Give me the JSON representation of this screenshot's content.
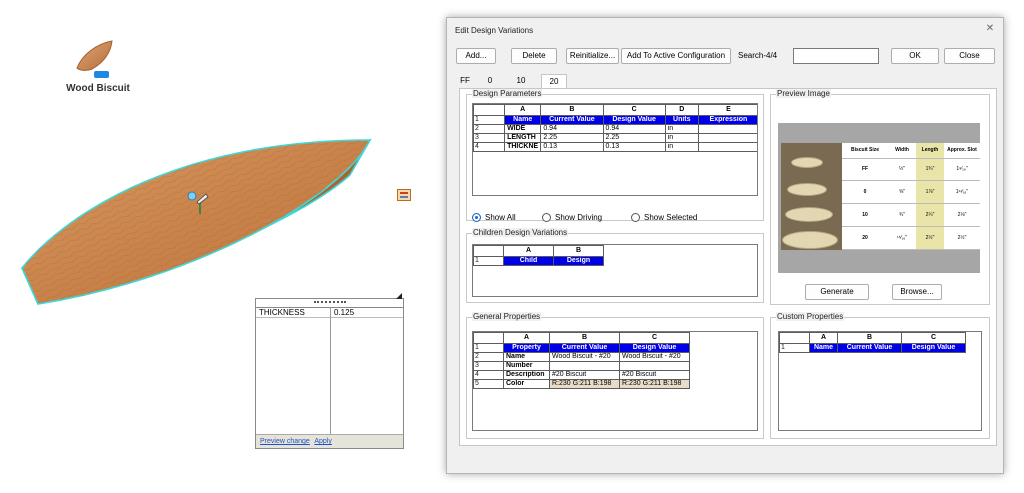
{
  "canvas": {
    "part_label": "Wood Biscuit",
    "part_badge": "•••",
    "equation": {
      "param_name": "THICKNESS",
      "param_value": "0.125",
      "preview_link": "Preview change",
      "apply_link": "Apply"
    }
  },
  "dialog": {
    "title": "Edit Design Variations",
    "toolbar": {
      "add": "Add...",
      "delete": "Delete",
      "reinitialize": "Reinitialize...",
      "add_to_config": "Add To Active Configuration",
      "search_label": "Search-4/4",
      "search_value": "",
      "ok": "OK",
      "close": "Close"
    },
    "tabs": [
      "FF",
      "0",
      "10",
      "20"
    ],
    "active_tab": "20",
    "design_parameters": {
      "label": "Design Parameters",
      "columns": [
        "A",
        "B",
        "C",
        "D",
        "E"
      ],
      "headers": [
        "Name",
        "Current Value",
        "Design Value",
        "Units",
        "Expression"
      ],
      "rows": [
        {
          "n": "2",
          "name": "WIDE",
          "current": "0.94",
          "design": "0.94",
          "units": "in",
          "expr": ""
        },
        {
          "n": "3",
          "name": "LENGTH",
          "current": "2.25",
          "design": "2.25",
          "units": "in",
          "expr": ""
        },
        {
          "n": "4",
          "name": "THICKNE",
          "current": "0.13",
          "design": "0.13",
          "units": "in",
          "expr": ""
        }
      ],
      "radio_all": "Show All",
      "radio_driving": "Show Driving",
      "radio_selected": "Show Selected"
    },
    "children": {
      "label": "Children Design Variations",
      "columns": [
        "A",
        "B"
      ],
      "headers": [
        "Child",
        "Design"
      ]
    },
    "preview": {
      "label": "Preview Image",
      "table_headers": [
        "Biscuit Size",
        "Width",
        "Length",
        "Approx. Slot"
      ],
      "table_rows": [
        [
          "FF",
          "½\"",
          "1¾\"",
          "1⁹⁄₁₆\""
        ],
        [
          "0",
          "⅝\"",
          "1⅞\"",
          "1¹¹⁄₁₆\""
        ],
        [
          "10",
          "¾\"",
          "2¼\"",
          "2⅛\""
        ],
        [
          "20",
          "¹⁵⁄₁₆\"",
          "2½\"",
          "2½\""
        ]
      ],
      "generate": "Generate",
      "browse": "Browse..."
    },
    "general": {
      "label": "General Properties",
      "columns": [
        "A",
        "B",
        "C"
      ],
      "headers": [
        "Property",
        "Current Value",
        "Design Value"
      ],
      "rows": [
        {
          "n": "2",
          "prop": "Name",
          "current": "Wood Biscuit - #20",
          "design": "Wood Biscuit - #20"
        },
        {
          "n": "3",
          "prop": "Number",
          "current": "",
          "design": ""
        },
        {
          "n": "4",
          "prop": "Description",
          "current": "#20 Biscuit",
          "design": "#20 Biscuit"
        },
        {
          "n": "5",
          "prop": "Color",
          "current": "R:230 G:211 B:198",
          "design": "R:230 G:211 B:198"
        }
      ]
    },
    "custom": {
      "label": "Custom Properties",
      "columns": [
        "A",
        "B",
        "C"
      ],
      "headers": [
        "Name",
        "Current Value",
        "Design Value"
      ]
    }
  },
  "colors": {
    "header_blue": "#0000e6",
    "selection_cyan": "#3fd8d8",
    "wood": "#c9834a",
    "color_cell": "#e8dcc8"
  }
}
